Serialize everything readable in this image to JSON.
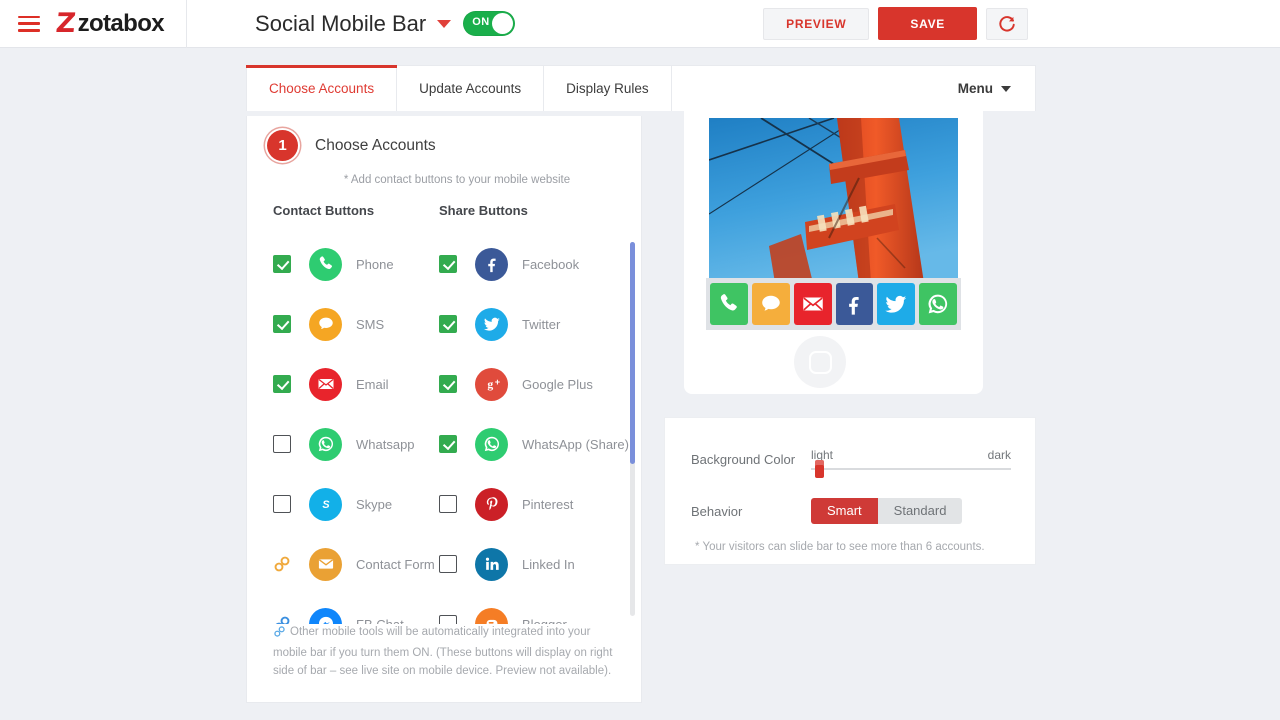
{
  "header": {
    "menu_icon": "hamburger-icon",
    "brand_mark": "Z",
    "brand_text": "zotabox",
    "page_title": "Social Mobile Bar",
    "title_caret": "chevron-down-icon",
    "toggle_label": "ON",
    "toggle_state": "on",
    "preview_label": "PREVIEW",
    "save_label": "SAVE",
    "refresh_icon": "refresh-icon",
    "accent_red": "#d8352c",
    "toggle_green": "#1aaf4b"
  },
  "tabs": {
    "items": [
      {
        "label": "Choose Accounts",
        "active": true
      },
      {
        "label": "Update Accounts",
        "active": false
      },
      {
        "label": "Display Rules",
        "active": false
      }
    ],
    "menu_label": "Menu",
    "menu_caret": "caret-down-icon"
  },
  "step": {
    "number": "1",
    "title": "Choose Accounts",
    "subtitle": "* Add contact buttons to your mobile website",
    "col_contact": "Contact Buttons",
    "col_share": "Share Buttons"
  },
  "contact_buttons": [
    {
      "label": "Phone",
      "checked": true,
      "control": "checkbox",
      "icon": "phone-icon",
      "color": "#2ecc71",
      "glyph": "✆"
    },
    {
      "label": "SMS",
      "checked": true,
      "control": "checkbox",
      "icon": "sms-icon",
      "color": "#f5a623",
      "glyph": "ὊC"
    },
    {
      "label": "Email",
      "checked": true,
      "control": "checkbox",
      "icon": "email-icon",
      "color": "#e8242c",
      "glyph": "✉"
    },
    {
      "label": "Whatsapp",
      "checked": false,
      "control": "checkbox",
      "icon": "whatsapp-icon",
      "color": "#2ecc71",
      "glyph": "✆"
    },
    {
      "label": "Skype",
      "checked": false,
      "control": "checkbox",
      "icon": "skype-icon",
      "color": "#12b0e8",
      "glyph": "S"
    },
    {
      "label": "Contact Form",
      "checked": false,
      "control": "link",
      "icon": "contact-form-icon",
      "color": "#eaa134",
      "glyph": "✉",
      "link_color": "#f0a93c"
    },
    {
      "label": "FB Chat",
      "checked": false,
      "control": "link",
      "icon": "fb-chat-icon",
      "color": "#0f86fb",
      "glyph": "⚡",
      "link_color": "#3a8fe0"
    }
  ],
  "share_buttons": [
    {
      "label": "Facebook",
      "checked": true,
      "control": "checkbox",
      "icon": "facebook-icon",
      "color": "#3b5998",
      "glyph": "f"
    },
    {
      "label": "Twitter",
      "checked": true,
      "control": "checkbox",
      "icon": "twitter-icon",
      "color": "#1eabe8",
      "glyph": "ὂ6"
    },
    {
      "label": "Google Plus",
      "checked": true,
      "control": "checkbox",
      "icon": "google-plus-icon",
      "color": "#e04b3c",
      "glyph": "g+"
    },
    {
      "label": "WhatsApp (Share)",
      "checked": true,
      "control": "checkbox",
      "icon": "whatsapp-icon",
      "color": "#2ecc71",
      "glyph": "✆"
    },
    {
      "label": "Pinterest",
      "checked": false,
      "control": "checkbox",
      "icon": "pinterest-icon",
      "color": "#cb2027",
      "glyph": "P"
    },
    {
      "label": "Linked In",
      "checked": false,
      "control": "checkbox",
      "icon": "linkedin-icon",
      "color": "#0e76a8",
      "glyph": "in"
    },
    {
      "label": "Blogger",
      "checked": false,
      "control": "checkbox",
      "icon": "blogger-icon",
      "color": "#f57d25",
      "glyph": "B"
    }
  ],
  "left_card_note": "Other mobile tools will be automatically integrated into your mobile bar if you turn them ON. (These buttons will display on right side of bar – see live site on mobile device. Preview not available).",
  "preview": {
    "image_alt": "golden-gate-bridge-photo",
    "bar_buttons": [
      {
        "icon": "phone-icon",
        "color": "#3fc463",
        "glyph": "✆"
      },
      {
        "icon": "sms-icon",
        "color": "#f5ae3c",
        "glyph": "ὊC"
      },
      {
        "icon": "email-icon",
        "color": "#e8242c",
        "glyph": "✉"
      },
      {
        "icon": "facebook-icon",
        "color": "#3b5998",
        "glyph": "f"
      },
      {
        "icon": "twitter-icon",
        "color": "#1eabe8",
        "glyph": "ὂ6"
      },
      {
        "icon": "whatsapp-icon",
        "color": "#3fc463",
        "glyph": "✆"
      }
    ],
    "home_button": "home-button-icon"
  },
  "settings": {
    "bg_label": "Background Color",
    "slider_min_label": "light",
    "slider_max_label": "dark",
    "slider_value_pct": 4,
    "behavior_label": "Behavior",
    "behavior_options": [
      {
        "label": "Smart",
        "selected": true
      },
      {
        "label": "Standard",
        "selected": false
      }
    ],
    "note": "* Your visitors can slide bar to see more than 6 accounts."
  }
}
